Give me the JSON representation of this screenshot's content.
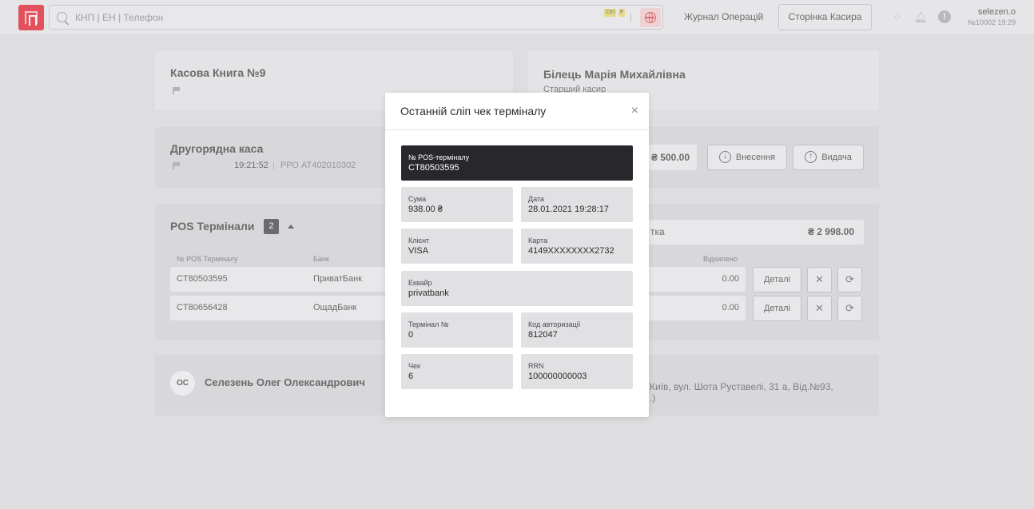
{
  "topbar": {
    "search_placeholder": "КНП | ЕН | Телефон",
    "kbd_ctrl": "Ctrl",
    "kbd_f": "F",
    "journal_link": "Журнал Операцій",
    "cashier_page_button": "Сторінка Касира",
    "username": "selezen.o",
    "user_sub": "№10002 19:29"
  },
  "cashbook": {
    "title": "Касова Книга №9"
  },
  "cashier_card": {
    "name": "Білець Марія Михайлівна",
    "role": "Старший касир"
  },
  "secondary_register": {
    "title": "Другорядна каса",
    "time": "19:21:52",
    "rro": "РРО АТ402010302",
    "balance": "₴ 500.00",
    "deposit_button": "Внесення",
    "withdraw_button": "Видача"
  },
  "pos": {
    "title": "POS Термінали",
    "count": "2",
    "summary_label": "тка",
    "summary_value": "₴ 2 998.00",
    "headers": {
      "terminal": "№ POS Терміналу",
      "bank": "Банк",
      "rejected": "Відхилено"
    },
    "rows": [
      {
        "terminal": "CT80503595",
        "bank": "ПриватБанк",
        "rejected": "0.00",
        "details": "Деталі"
      },
      {
        "terminal": "CT80656428",
        "bank": "ОщадБанк",
        "rejected": "0.00",
        "details": "Деталі"
      }
    ]
  },
  "employee": {
    "initials": "ОС",
    "name": "Селезень Олег Олександрович",
    "address_line1": "Київ, вул. Шота Руставелі, 31 а, Від.№93,",
    "address_line2": ".)"
  },
  "modal": {
    "title": "Останній сліп чек терміналу",
    "fields": {
      "pos_terminal": {
        "label": "№ POS-терміналу",
        "value": "CT80503595"
      },
      "amount": {
        "label": "Сума",
        "value": "938.00 ₴"
      },
      "date": {
        "label": "Дата",
        "value": "28.01.2021 19:28:17"
      },
      "client": {
        "label": "Клієнт",
        "value": "VISA"
      },
      "card": {
        "label": "Карта",
        "value": "4149XXXXXXXX2732"
      },
      "acquirer": {
        "label": "Еквайр",
        "value": "privatbank"
      },
      "terminal_no": {
        "label": "Термінал №",
        "value": "0"
      },
      "auth_code": {
        "label": "Код авторизації",
        "value": "812047"
      },
      "check": {
        "label": "Чек",
        "value": "6"
      },
      "rrn": {
        "label": "RRN",
        "value": "100000000003"
      }
    }
  },
  "icons": {
    "close": "×",
    "details_close": "✕",
    "refresh": "⟳",
    "arrow_down": "↓",
    "arrow_up": "↑"
  },
  "colors": {
    "brand": "#e30613",
    "modal_dark_field": "#28282c"
  }
}
